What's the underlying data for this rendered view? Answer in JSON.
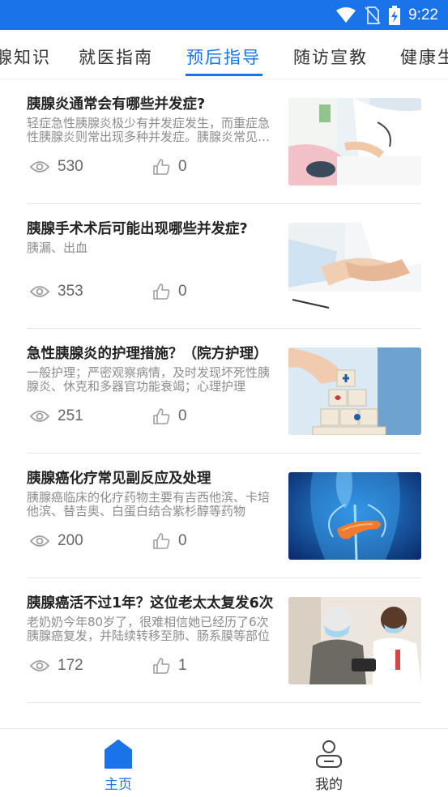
{
  "status_bar": {
    "time": "9:22",
    "icons": [
      "wifi-icon",
      "no-sim-icon",
      "battery-charging-icon"
    ],
    "background": "#1a73e8"
  },
  "tabs": [
    {
      "label": "腺知识",
      "active": false
    },
    {
      "label": "就医指南",
      "active": false
    },
    {
      "label": "预后指导",
      "active": true
    },
    {
      "label": "随访宣教",
      "active": false
    },
    {
      "label": "健康生",
      "active": false
    }
  ],
  "articles": [
    {
      "title": "胰腺炎通常会有哪些并发症?",
      "summary": "轻症急性胰腺炎极少有并发症发生，而重症急性胰腺炎则常出现多种并发症。胰腺炎常见并发症",
      "views": "530",
      "likes": "0",
      "image": "doctor-blood-pressure-image"
    },
    {
      "title": "胰腺手术术后可能出现哪些并发症?",
      "summary": "胰漏、出血",
      "views": "353",
      "likes": "0",
      "image": "holding-hands-image"
    },
    {
      "title": "急性胰腺炎的护理措施？（院方护理）",
      "summary": "一般护理；严密观察病情，及时发现坏死性胰腺炎、休克和多器官功能衰竭；心理护理",
      "views": "251",
      "likes": "0",
      "image": "medical-blocks-image"
    },
    {
      "title": "胰腺癌化疗常见副反应及处理",
      "summary": "胰腺癌临床的化疗药物主要有吉西他滨、卡培他滨、替吉奥、白蛋白结合紫杉醇等药物",
      "views": "200",
      "likes": "0",
      "image": "pancreas-anatomy-image"
    },
    {
      "title": "胰腺癌活不过1年？这位老太太复发6次",
      "summary": "老奶奶今年80岁了，很难相信她已经历了6次胰腺癌复发，并陆续转移至肺、肠系膜等部位",
      "views": "172",
      "likes": "1",
      "image": "nurse-elderly-patient-image"
    }
  ],
  "bottom_nav": [
    {
      "label": "主页",
      "icon": "home-icon",
      "active": true
    },
    {
      "label": "我的",
      "icon": "profile-icon",
      "active": false
    }
  ],
  "colors": {
    "accent": "#1a73e8",
    "text_dark": "#222222",
    "text_muted": "#8c8c8c"
  }
}
